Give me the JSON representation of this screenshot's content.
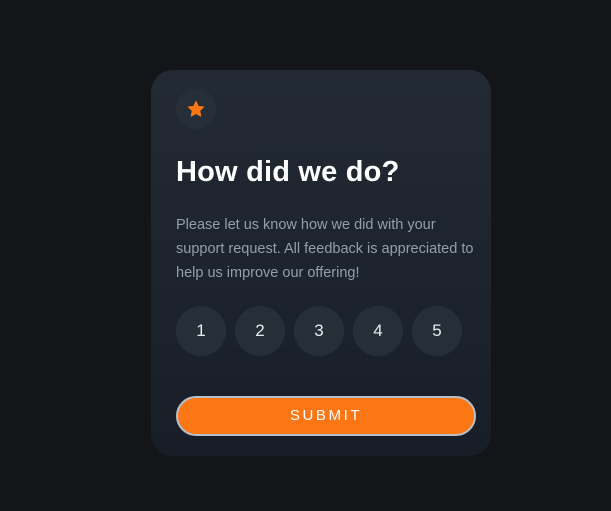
{
  "card": {
    "icon": "star-icon",
    "title": "How did we do?",
    "description": "Please let us know how we did with your support request. All feedback is appreciated to help us improve our offering!",
    "ratings": [
      "1",
      "2",
      "3",
      "4",
      "5"
    ],
    "submit_label": "SUBMIT"
  },
  "colors": {
    "background": "#131518",
    "card": "#1f2630",
    "accent": "#fc7614",
    "circle": "#262f38",
    "text_muted": "#959eac"
  }
}
